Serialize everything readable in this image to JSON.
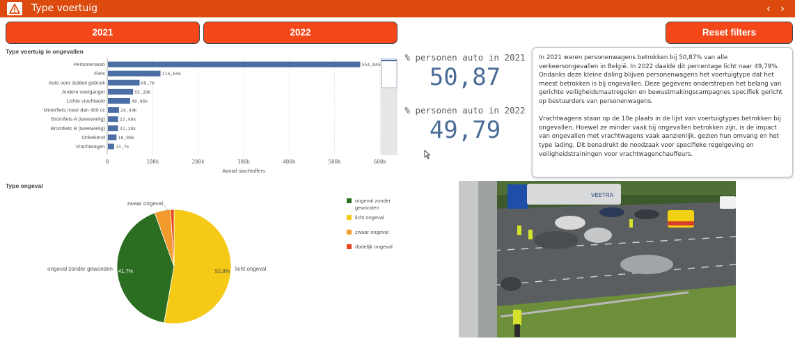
{
  "header": {
    "title": "Type voertuig",
    "nav_prev": "‹",
    "nav_next": "›"
  },
  "filters": {
    "year1_label": "2021",
    "year2_label": "2022",
    "reset_label": "Reset filters"
  },
  "vehicle_chart": {
    "section_title": "Type voertuig in ongevallen",
    "chart_data": {
      "type": "bar",
      "orientation": "horizontal",
      "categories": [
        "Personenauto",
        "Fiets",
        "Auto voor dubbel gebruik",
        "Andere voetganger",
        "Lichte vrachtauto",
        "Motorfiets meer dan 400 cc",
        "Bromfiets A (tweewielig)",
        "Bromfiets B (tweewielig)",
        "Onbekend",
        "Vrachtwagen"
      ],
      "values": [
        554.84,
        115.64,
        69.7,
        55.29,
        48.86,
        24.44,
        22.48,
        22.28,
        18.99,
        13.7
      ],
      "value_labels": [
        "554,84k",
        "115,64k",
        "69,7k",
        "55,29k",
        "48,86k",
        "24,44k",
        "22,48k",
        "22,28k",
        "18,99k",
        "13,7k"
      ],
      "xlim": [
        0,
        600
      ],
      "xticks": [
        "0",
        "100k",
        "200k",
        "300k",
        "400k",
        "500k",
        "600k"
      ],
      "xlabel": "Aantal slachtoffers",
      "ylabel": "",
      "color": "#4b6fa5",
      "grid": true
    }
  },
  "kpis": {
    "label_2021": "% personen auto in 2021",
    "value_2021": "50,87",
    "label_2022": "% personen auto in 2022",
    "value_2022": "49,79"
  },
  "textbox": {
    "paragraph1": "In 2021 waren personenwagens betrokken bij 50,87% van alle verkeersongevallen in België. In 2022 daalde dit percentage licht naar 49,79%. Ondanks deze kleine daling blijven personenwagens het voertuigtype dat het meest betrokken is bij ongevallen. Deze gegevens onderstrepen het belang van gerichte veiligheidsmaatregelen en bewustmakingscampagnes specifiek gericht op bestuurders van personenwagens.",
    "paragraph2": "Vrachtwagens staan op de 10e plaats in de lijst van voertuigtypes betrokken bij ongevallen. Hoewel ze minder vaak bij ongevallen betrokken zijn, is de impact van ongevallen met vrachtwagens vaak aanzienlijk, gezien hun omvang en het type lading. Dit benadrukt de noodzaak voor specifieke regelgeving en veiligheidstrainingen voor vrachtwagenchauffeurs."
  },
  "accident_chart": {
    "section_title": "Type ongeval",
    "chart_data": {
      "type": "pie",
      "slices": [
        {
          "name": "licht ongeval",
          "value": 52.8,
          "label": "52,8%",
          "color": "#f4ca16"
        },
        {
          "name": "ongeval zonder gewonden",
          "value": 41.7,
          "label": "41,7%",
          "color": "#2b6e22"
        },
        {
          "name": "zwaar ongeval",
          "value": 4.5,
          "label": "",
          "color": "#f29a2e"
        },
        {
          "name": "dodelijk ongeval",
          "value": 1.0,
          "label": "",
          "color": "#e8451c"
        }
      ],
      "outer_labels": [
        "licht ongeval",
        "ongeval zonder gewonden",
        "zwaar ongeval"
      ],
      "legend": [
        {
          "label": "ongeval zonder gewonden",
          "color": "#2b6e22"
        },
        {
          "label": "licht ongeval",
          "color": "#f4ca16"
        },
        {
          "label": "zwaar ongeval",
          "color": "#f29a2e"
        },
        {
          "label": "dodelijk ongeval",
          "color": "#e8451c"
        }
      ],
      "legend_position": "right"
    }
  },
  "photo": {
    "truck_brand": "VEETRA"
  },
  "colors": {
    "header": "#dc4a0d",
    "button": "#f4481b",
    "kpi": "#4b6c96",
    "bar": "#4b6fa5"
  }
}
